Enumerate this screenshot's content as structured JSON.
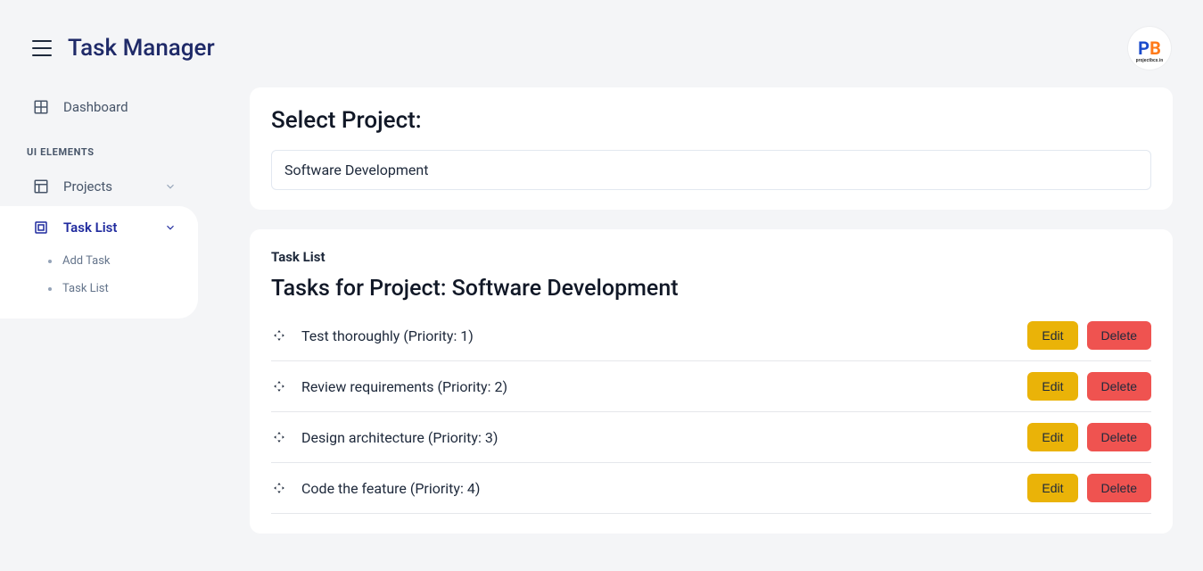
{
  "header": {
    "app_title": "Task Manager",
    "avatar_p": "P",
    "avatar_b": "B",
    "avatar_sub": "projectbcs.in"
  },
  "sidebar": {
    "dashboard_label": "Dashboard",
    "section_label": "UI ELEMENTS",
    "projects_label": "Projects",
    "tasklist_label": "Task List",
    "sub_add_task": "Add Task",
    "sub_task_list": "Task List"
  },
  "select_card": {
    "title": "Select Project:",
    "value": "Software Development"
  },
  "task_card": {
    "subtitle": "Task List",
    "heading_prefix": "Tasks for Project: ",
    "heading_project": "Software Development",
    "edit_label": "Edit",
    "delete_label": "Delete",
    "tasks": [
      {
        "label": "Test thoroughly (Priority: 1)"
      },
      {
        "label": "Review requirements (Priority: 2)"
      },
      {
        "label": "Design architecture (Priority: 3)"
      },
      {
        "label": "Code the feature (Priority: 4)"
      }
    ]
  }
}
